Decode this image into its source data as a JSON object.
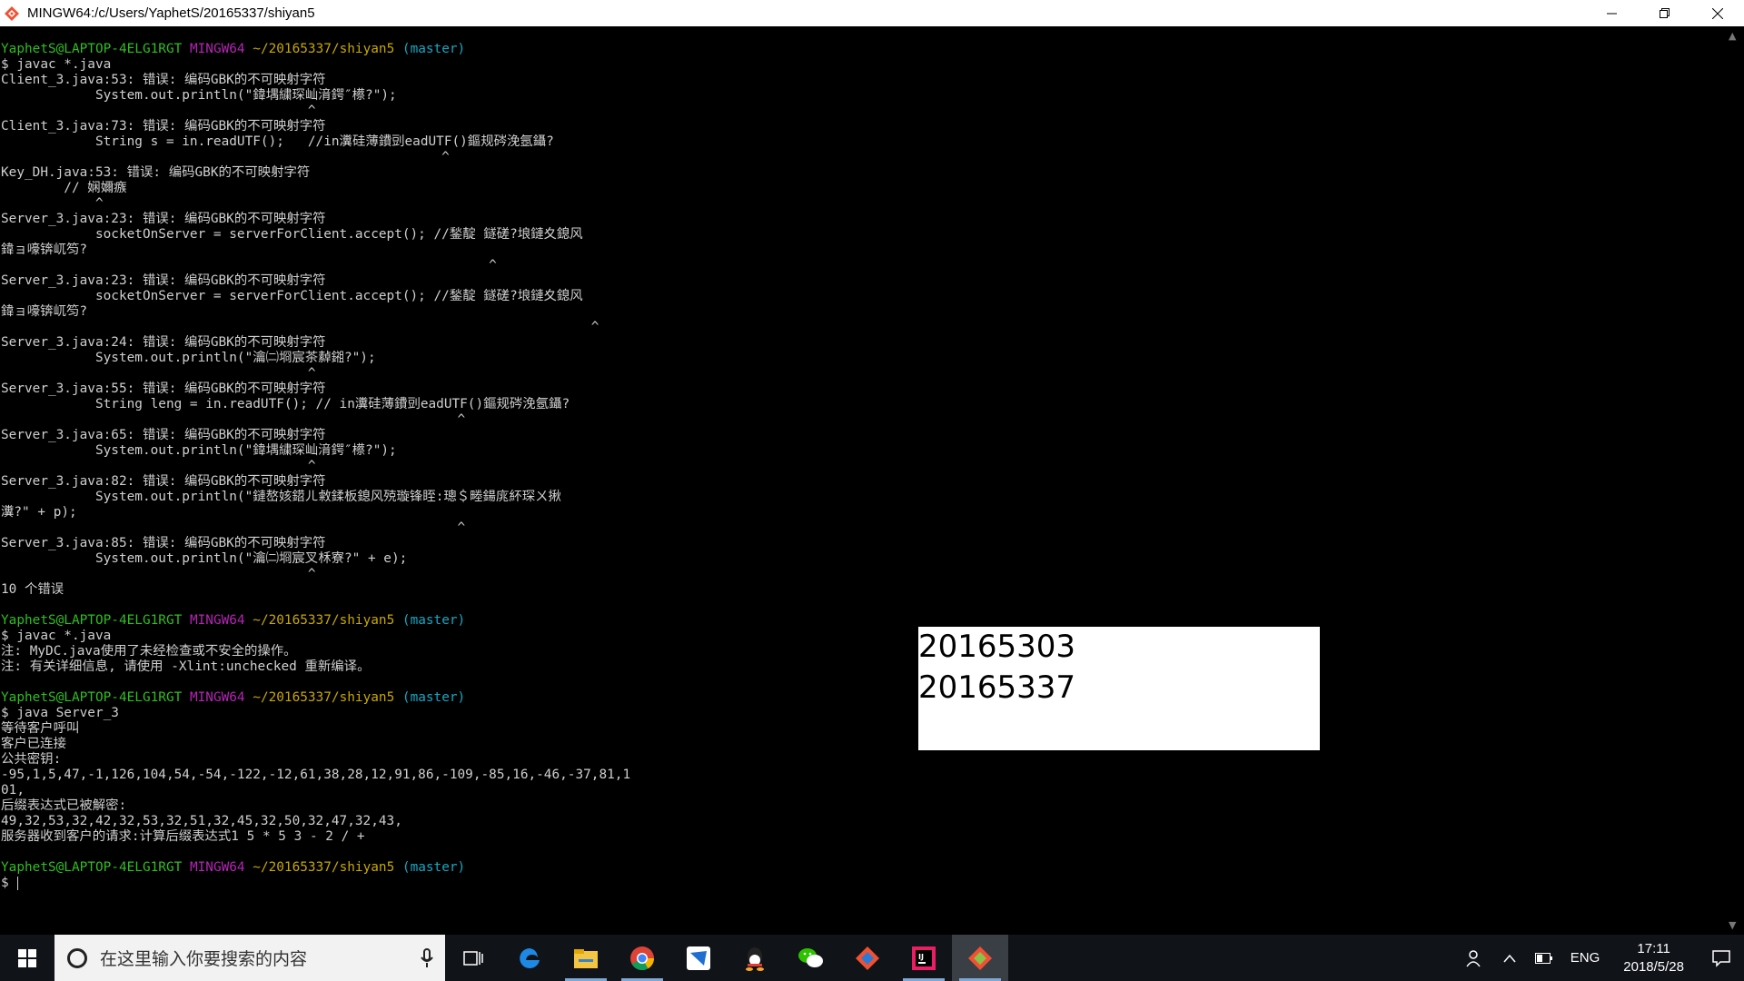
{
  "window": {
    "title": "MINGW64:/c/Users/YaphetS/20165337/shiyan5",
    "icon": "git-bash-icon"
  },
  "terminal": {
    "lines": [
      {
        "prompt": true,
        "user": "YaphetS@LAPTOP-4ELG1RGT",
        "env": "MINGW64",
        "path": "~/20165337/shiyan5",
        "branch": "(master)"
      },
      {
        "text": "$ javac *.java"
      },
      {
        "text": "Client_3.java:53: 错误: 编码GBK的不可映射字符"
      },
      {
        "text": "            System.out.println(\"鍏堣繍琛屾湇鍔″櫒?\");"
      },
      {
        "text": "                                       ^"
      },
      {
        "text": "Client_3.java:73: 错误: 编码GBK的不可映射字符"
      },
      {
        "text": "            String s = in.readUTF();   //in瀵硅薄鐨剅eadUTF()鏂规硶浼氬鑷?"
      },
      {
        "text": "                                                        ^"
      },
      {
        "text": "Key_DH.java:53: 错误: 编码GBK的不可映射字符"
      },
      {
        "text": "        // 娴嬭瘯"
      },
      {
        "text": "            ^"
      },
      {
        "text": "Server_3.java:23: 错误: 编码GBK的不可映射字符"
      },
      {
        "text": "            socketOnServer = serverForClient.accept(); //鍫靛 鐩磋?埌鏈夊鎴风"
      },
      {
        "text": "鍏ョ嚎锛屼笉?"
      },
      {
        "text": "                                                              ^"
      },
      {
        "text": "Server_3.java:23: 错误: 编码GBK的不可映射字符"
      },
      {
        "text": "            socketOnServer = serverForClient.accept(); //鍫靛 鐩磋?埌鏈夊鎴风"
      },
      {
        "text": "鍏ョ嚎锛屼笉?"
      },
      {
        "text": "                                                                           ^"
      },
      {
        "text": "Server_3.java:24: 错误: 编码GBK的不可映射字符"
      },
      {
        "text": "            System.out.println(\"瀹㈡埛宸茶繛鎺?\");"
      },
      {
        "text": "                                       ^"
      },
      {
        "text": "Server_3.java:55: 错误: 编码GBK的不可映射字符"
      },
      {
        "text": "            String leng = in.readUTF(); // in瀵硅薄鐨剅eadUTF()鏂规硶浼氬鑷?"
      },
      {
        "text": "                                                          ^"
      },
      {
        "text": "Server_3.java:65: 错误: 编码GBK的不可映射字符"
      },
      {
        "text": "            System.out.println(\"鍏堣繍琛屾湇鍔″櫒?\");"
      },
      {
        "text": "                                       ^"
      },
      {
        "text": "Server_3.java:82: 错误: 编码GBK的不可映射字符"
      },
      {
        "text": "            System.out.println(\"鏈嶅姟鍣ㄦ敹鍒板鎴风殑璇锋眰:璁＄畻鍚庣紑琛ㄨ揪"
      },
      {
        "text": "瀵?\" + p);"
      },
      {
        "text": "                                                          ^"
      },
      {
        "text": "Server_3.java:85: 错误: 编码GBK的不可映射字符"
      },
      {
        "text": "            System.out.println(\"瀹㈡埛宸叉柇寮?\" + e);"
      },
      {
        "text": "                                       ^"
      },
      {
        "text": "10 个错误"
      },
      {
        "text": ""
      },
      {
        "prompt": true,
        "user": "YaphetS@LAPTOP-4ELG1RGT",
        "env": "MINGW64",
        "path": "~/20165337/shiyan5",
        "branch": "(master)"
      },
      {
        "text": "$ javac *.java"
      },
      {
        "text": "注: MyDC.java使用了未经检查或不安全的操作。"
      },
      {
        "text": "注: 有关详细信息, 请使用 -Xlint:unchecked 重新编译。"
      },
      {
        "text": ""
      },
      {
        "prompt": true,
        "user": "YaphetS@LAPTOP-4ELG1RGT",
        "env": "MINGW64",
        "path": "~/20165337/shiyan5",
        "branch": "(master)"
      },
      {
        "text": "$ java Server_3"
      },
      {
        "text": "等待客户呼叫"
      },
      {
        "text": "客户已连接"
      },
      {
        "text": "公共密钥:"
      },
      {
        "text": "-95,1,5,47,-1,126,104,54,-54,-122,-12,61,38,28,12,91,86,-109,-85,16,-46,-37,81,1"
      },
      {
        "text": "01,"
      },
      {
        "text": "后缀表达式已被解密:"
      },
      {
        "text": "49,32,53,32,42,32,53,32,51,32,45,32,50,32,47,32,43,"
      },
      {
        "text": "服务器收到客户的请求:计算后缀表达式1 5 * 5 3 - 2 / +"
      },
      {
        "text": ""
      },
      {
        "prompt": true,
        "user": "YaphetS@LAPTOP-4ELG1RGT",
        "env": "MINGW64",
        "path": "~/20165337/shiyan5",
        "branch": "(master)"
      },
      {
        "text": "$ ",
        "cursor": true
      }
    ]
  },
  "overlay": {
    "line1": "20165303",
    "line2": "20165337"
  },
  "taskbar": {
    "search_placeholder": "在这里输入你要搜索的内容",
    "apps": [
      "task-view-icon",
      "edge-icon",
      "file-explorer-icon",
      "chrome-icon",
      "feishu-icon",
      "qq-icon",
      "wechat-icon",
      "git-gui-icon",
      "intellij-icon",
      "git-bash-icon"
    ],
    "language": "ENG",
    "time": "17:11",
    "date": "2018/5/28"
  },
  "colors": {
    "user": "#2fbf1f",
    "env": "#b624b6",
    "path": "#c7a800",
    "branch": "#14a8c4"
  }
}
